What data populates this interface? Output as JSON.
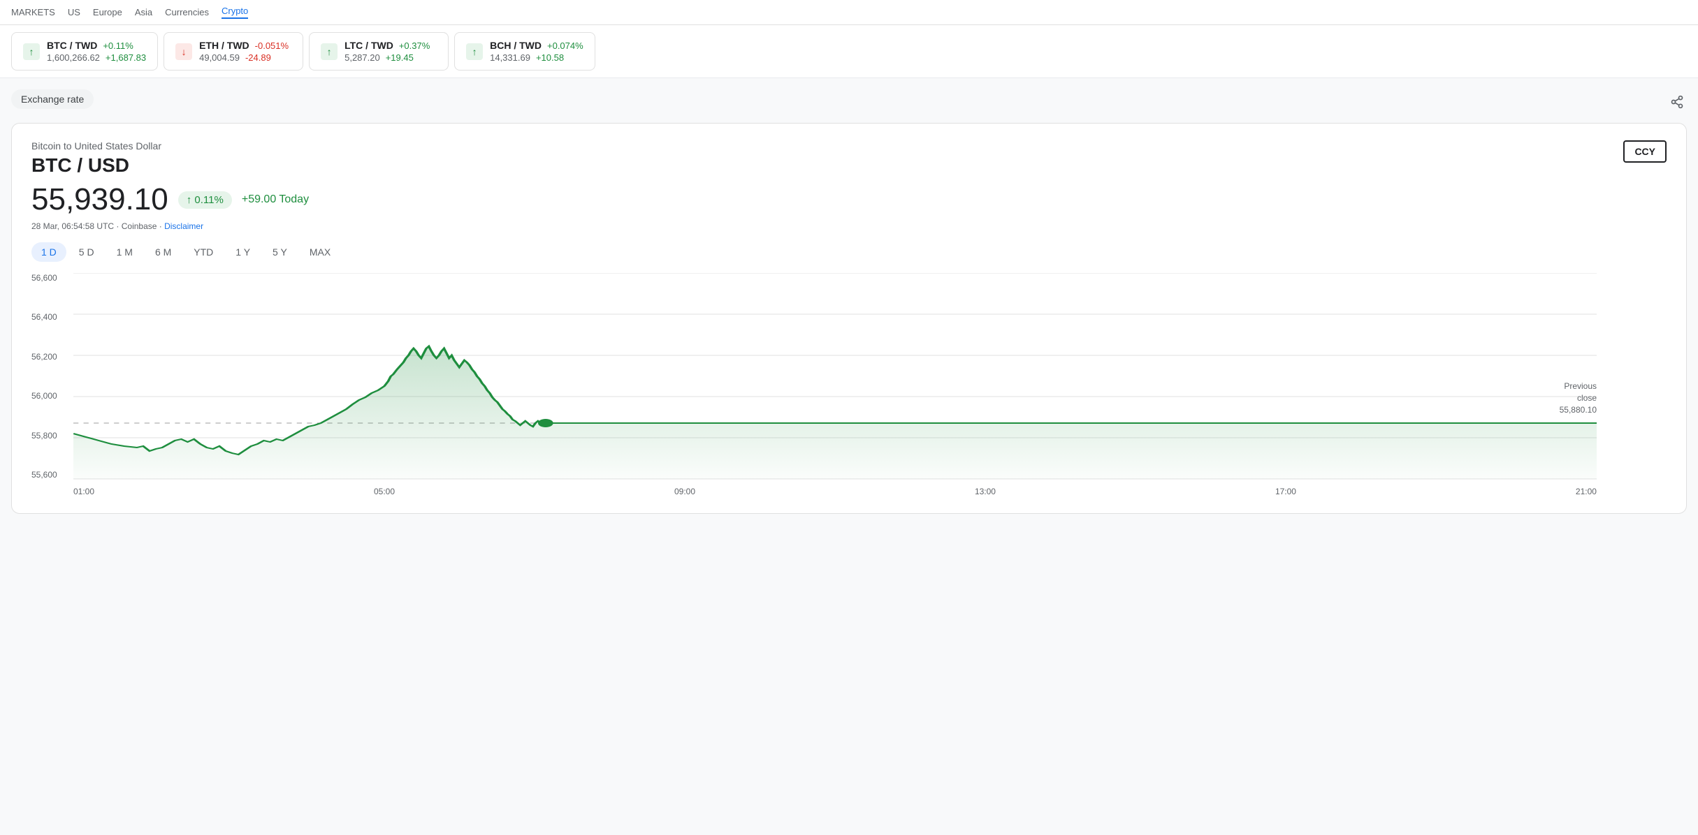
{
  "nav": {
    "links": [
      {
        "label": "MARKETS",
        "active": false
      },
      {
        "label": "US",
        "active": false
      },
      {
        "label": "Europe",
        "active": false
      },
      {
        "label": "Asia",
        "active": false
      },
      {
        "label": "Currencies",
        "active": false
      },
      {
        "label": "Crypto",
        "active": true
      }
    ]
  },
  "tickers": [
    {
      "name": "BTC / TWD",
      "price": "1,600,266.62",
      "changePercent": "+0.11%",
      "changeAbs": "+1,687.83",
      "direction": "up"
    },
    {
      "name": "ETH / TWD",
      "price": "49,004.59",
      "changePercent": "-0.051%",
      "changeAbs": "-24.89",
      "direction": "down"
    },
    {
      "name": "LTC / TWD",
      "price": "5,287.20",
      "changePercent": "+0.37%",
      "changeAbs": "+19.45",
      "direction": "up"
    },
    {
      "name": "BCH / TWD",
      "price": "14,331.69",
      "changePercent": "+0.074%",
      "changeAbs": "+10.58",
      "direction": "up"
    }
  ],
  "exchangeRateLabel": "Exchange rate",
  "shareIconLabel": "⋮",
  "chart": {
    "subtitle": "Bitcoin to United States Dollar",
    "pair": "BTC / USD",
    "price": "55,939.10",
    "badge": "↑ 0.11%",
    "todayChange": "+59.00 Today",
    "meta": "28 Mar, 06:54:58 UTC · Coinbase · Disclaimer",
    "ccyButton": "CCY",
    "timeTabs": [
      {
        "label": "1 D",
        "active": true
      },
      {
        "label": "5 D",
        "active": false
      },
      {
        "label": "1 M",
        "active": false
      },
      {
        "label": "6 M",
        "active": false
      },
      {
        "label": "YTD",
        "active": false
      },
      {
        "label": "1 Y",
        "active": false
      },
      {
        "label": "5 Y",
        "active": false
      },
      {
        "label": "MAX",
        "active": false
      }
    ],
    "yLabels": [
      "56,600",
      "56,400",
      "56,200",
      "56,000",
      "55,800",
      "55,600"
    ],
    "xLabels": [
      "01:00",
      "05:00",
      "09:00",
      "13:00",
      "17:00",
      "21:00"
    ],
    "previousClose": {
      "label": "Previous\nclose",
      "value": "55,880.10"
    }
  }
}
